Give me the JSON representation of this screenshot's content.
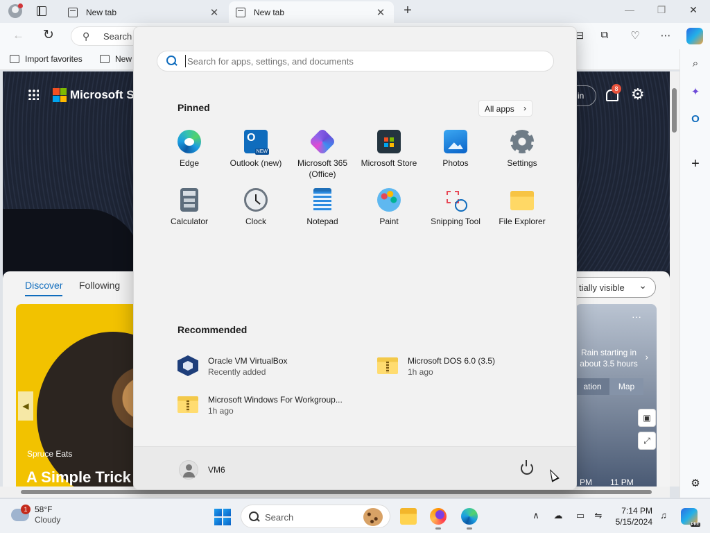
{
  "browser": {
    "tabs": [
      {
        "title": "New tab",
        "close": "✕"
      },
      {
        "title": "New tab",
        "close": "✕"
      }
    ],
    "new_tab_glyph": "+",
    "window_controls": {
      "minimize": "—",
      "restore": "❐",
      "close": "✕"
    },
    "address": {
      "search_glyph": "⚲",
      "text": "Search"
    },
    "toolbar_glyphs": {
      "back": "←",
      "reload": "↻",
      "more": "⋯"
    },
    "favorites": [
      {
        "label": "Import favorites"
      },
      {
        "label": "New"
      }
    ]
  },
  "page": {
    "brand": "Microsoft Start",
    "signin_label": "in",
    "notification_count": "8",
    "settings_glyph": "⚙",
    "feed_tabs": [
      "Discover",
      "Following"
    ],
    "visibility_label": "tially visible",
    "visibility_chevron": "⌄",
    "feed_card": {
      "source": "Spruce Eats",
      "headline": "A Simple Trick",
      "arrow": "◀"
    },
    "weather_card": {
      "more": "···",
      "text": "Rain starting in about 3.5 hours",
      "chevron": "›",
      "tabs": [
        "ation",
        "Map"
      ],
      "times": [
        "PM",
        "11 PM"
      ]
    },
    "side_buttons": [
      "▣",
      "⤢"
    ]
  },
  "sidebar": {
    "glyphs": {
      "search": "⌕",
      "add": "+",
      "settings": "⚙"
    }
  },
  "start_menu": {
    "search_placeholder": "Search for apps, settings, and documents",
    "pinned_title": "Pinned",
    "all_apps_label": "All apps",
    "all_apps_chevron": "›",
    "pinned_apps": [
      {
        "label": "Edge",
        "icon": "edge-icon"
      },
      {
        "label": "Outlook (new)",
        "icon": "outlook-icon"
      },
      {
        "label": "Microsoft 365 (Office)",
        "icon": "microsoft-365-icon"
      },
      {
        "label": "Microsoft Store",
        "icon": "store-icon"
      },
      {
        "label": "Photos",
        "icon": "photos-icon"
      },
      {
        "label": "Settings",
        "icon": "settings-icon"
      },
      {
        "label": "Calculator",
        "icon": "calculator-icon"
      },
      {
        "label": "Clock",
        "icon": "clock-icon"
      },
      {
        "label": "Notepad",
        "icon": "notepad-icon"
      },
      {
        "label": "Paint",
        "icon": "paint-icon"
      },
      {
        "label": "Snipping Tool",
        "icon": "snipping-tool-icon"
      },
      {
        "label": "File Explorer",
        "icon": "file-explorer-icon"
      }
    ],
    "recommended_title": "Recommended",
    "recommended": [
      {
        "title": "Oracle VM VirtualBox",
        "subtitle": "Recently added",
        "icon": "virtualbox-icon"
      },
      {
        "title": "Microsoft DOS 6.0 (3.5)",
        "subtitle": "1h ago",
        "icon": "zip-folder-icon"
      },
      {
        "title": "Microsoft Windows For Workgroup...",
        "subtitle": "1h ago",
        "icon": "zip-folder-icon"
      }
    ],
    "user_name": "VM6"
  },
  "taskbar": {
    "weather": {
      "temperature": "58°F",
      "condition": "Cloudy",
      "alert_count": "1"
    },
    "search_label": "Search",
    "tray_glyphs": {
      "chevron": "∧",
      "bell": "🔔"
    },
    "time": "7:14 PM",
    "date": "5/15/2024"
  }
}
